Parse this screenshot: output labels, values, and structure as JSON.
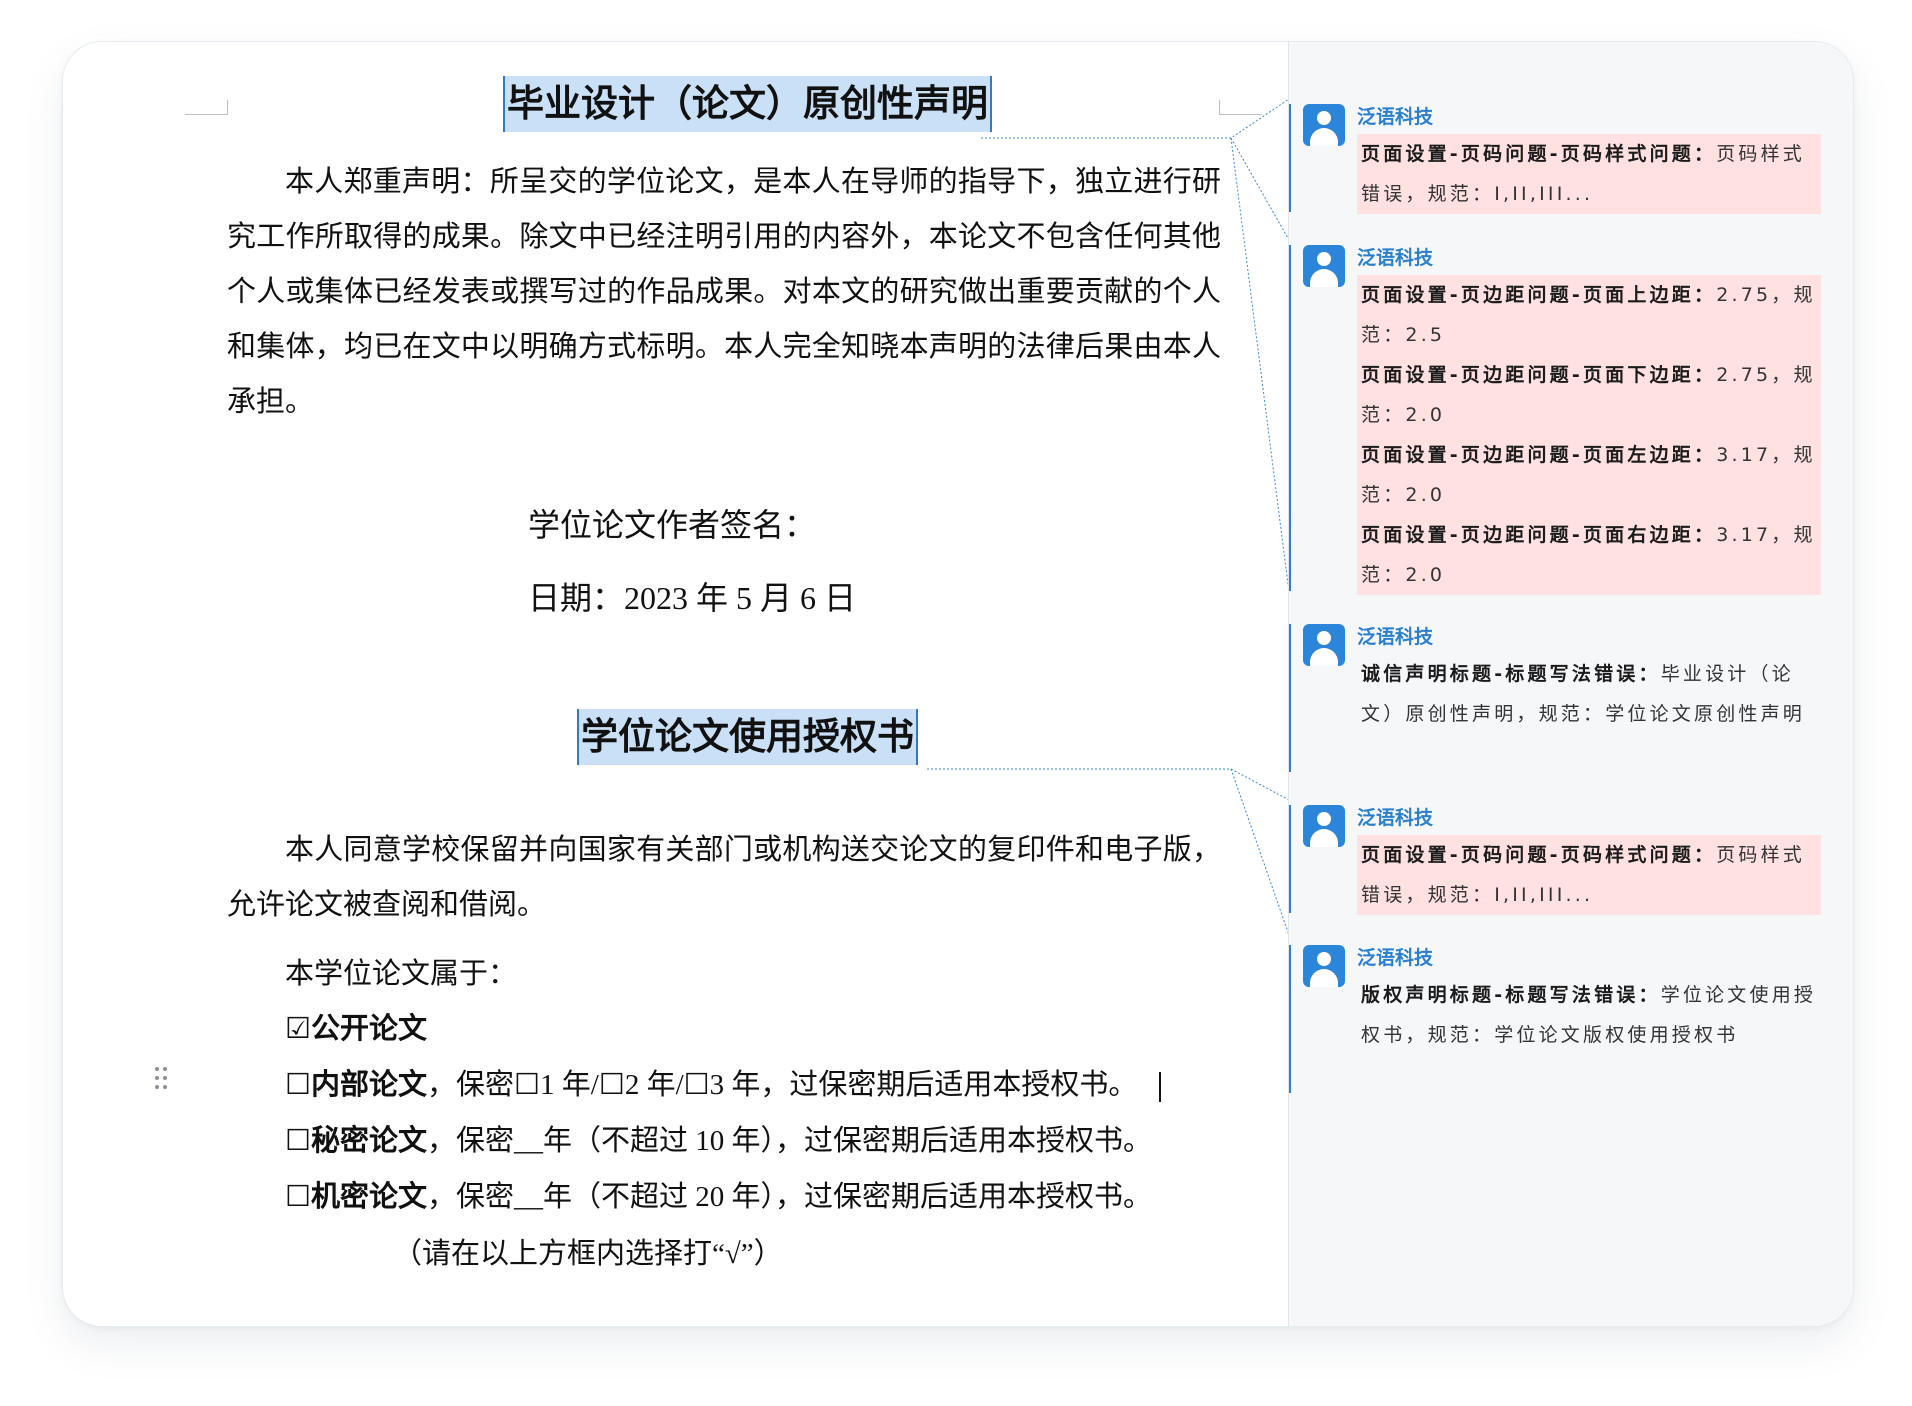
{
  "document": {
    "title1": "毕业设计（论文）原创性声明",
    "paragraph1": "本人郑重声明：所呈交的学位论文，是本人在导师的指导下，独立进行研究工作所取得的成果。除文中已经注明引用的内容外，本论文不包含任何其他个人或集体已经发表或撰写过的作品成果。对本文的研究做出重要贡献的个人和集体，均已在文中以明确方式标明。本人完全知晓本声明的法律后果由本人承担。",
    "signature_label": "学位论文作者签名：",
    "date_line": "日期：2023 年 5 月 6 日",
    "title2": "学位论文使用授权书",
    "paragraph2": "本人同意学校保留并向国家有关部门或机构送交论文的复印件和电子版，允许论文被查阅和借阅。",
    "belongs_label": "本学位论文属于：",
    "options": [
      {
        "box": "☑",
        "label": "公开论文",
        "rest": ""
      },
      {
        "box": "☐",
        "label": "内部论文",
        "rest": "，保密☐1 年/☐2 年/☐3 年，过保密期后适用本授权书。"
      },
      {
        "box": "☐",
        "label": "秘密论文",
        "rest": "，保密__年（不超过 10 年），过保密期后适用本授权书。"
      },
      {
        "box": "☐",
        "label": "机密论文",
        "rest": "，保密__年（不超过 20 年），过保密期后适用本授权书。"
      }
    ],
    "hint": "（请在以上方框内选择打“√”）"
  },
  "comments": [
    {
      "author": "泛语科技",
      "items": [
        {
          "head": "页面设置-页码问题-页码样式问题：",
          "text": "页码样式错误，规范：I,II,III...",
          "error": true
        }
      ]
    },
    {
      "author": "泛语科技",
      "items": [
        {
          "head": "页面设置-页边距问题-页面上边距：",
          "text": "2.75，规范：2.5",
          "error": true
        },
        {
          "head": "页面设置-页边距问题-页面下边距：",
          "text": "2.75，规范：2.0",
          "error": true
        },
        {
          "head": "页面设置-页边距问题-页面左边距：",
          "text": "3.17，规范：2.0",
          "error": true
        },
        {
          "head": "页面设置-页边距问题-页面右边距：",
          "text": "3.17，规范：2.0",
          "error": true
        }
      ]
    },
    {
      "author": "泛语科技",
      "items": [
        {
          "head": "诚信声明标题-标题写法错误：",
          "text": "毕业设计（论文）原创性声明，规范：学位论文原创性声明",
          "error": false
        }
      ]
    },
    {
      "author": "泛语科技",
      "items": [
        {
          "head": "页面设置-页码问题-页码样式问题：",
          "text": "页码样式错误，规范：I,II,III...",
          "error": true
        }
      ]
    },
    {
      "author": "泛语科技",
      "items": [
        {
          "head": "版权声明标题-标题写法错误：",
          "text": "学位论文使用授权书，规范：学位论文版权使用授权书",
          "error": false
        }
      ]
    }
  ],
  "colors": {
    "accent": "#2b85d9",
    "highlight": "#c9e0f6",
    "error_bg": "#ffe1e1"
  }
}
